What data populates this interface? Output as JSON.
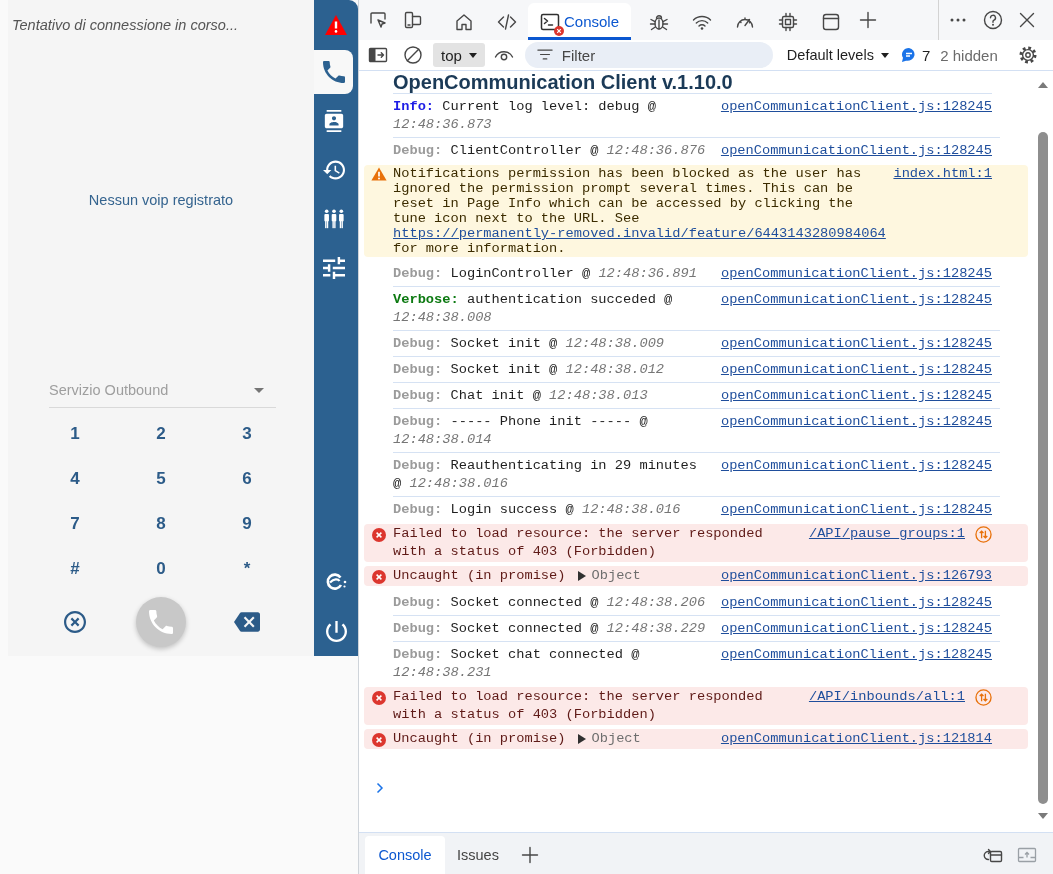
{
  "app": {
    "status": "Tentativo di connessione in corso...",
    "voip_message": "Nessun voip registrato",
    "service_select": {
      "placeholder": "Servizio Outbound"
    },
    "keypad": [
      "1",
      "2",
      "3",
      "4",
      "5",
      "6",
      "7",
      "8",
      "9",
      "#",
      "0",
      "*"
    ],
    "call_button": {
      "disabled": true
    }
  },
  "sidebar": {
    "alert": true,
    "items": [
      {
        "kind": "phone",
        "selected": true
      },
      {
        "kind": "contacts",
        "selected": false
      },
      {
        "kind": "history",
        "selected": false
      },
      {
        "kind": "people",
        "selected": false
      },
      {
        "kind": "tune",
        "selected": false
      }
    ]
  },
  "devtools": {
    "tabs": [
      {
        "kind": "home",
        "selected": false,
        "error_badge": false
      },
      {
        "kind": "code",
        "selected": false,
        "error_badge": false
      },
      {
        "kind": "console",
        "label": "Console",
        "selected": true,
        "error_badge": true
      },
      {
        "kind": "bug",
        "selected": false,
        "error_badge": false
      },
      {
        "kind": "wifi",
        "selected": false,
        "error_badge": false
      },
      {
        "kind": "gauge",
        "selected": false,
        "error_badge": false
      },
      {
        "kind": "chip",
        "selected": false,
        "error_badge": false
      },
      {
        "kind": "window",
        "selected": false,
        "error_badge": false
      }
    ],
    "toolbar": {
      "context": "top",
      "filter": {
        "placeholder": "Filter"
      },
      "levels": "Default levels",
      "message_count": "7",
      "hidden": "2 hidden"
    },
    "console": {
      "heading": "OpenCommunication Client v.1.10.0",
      "messages": [
        {
          "kind": "info",
          "prefix": "Info:",
          "text": "Current log level: debug @",
          "time": "12:48:36.873",
          "source": "openCommunicationClient.js:128245"
        },
        {
          "kind": "debug",
          "prefix": "Debug:",
          "text": "ClientController @",
          "time": "12:48:36.876",
          "source": "openCommunicationClient.js:128245"
        },
        {
          "kind": "warning",
          "text": "Notifications permission has been blocked as the user has ignored the permission prompt several times. This can be reset in Page Info which can be accessed by clicking the tune icon next to the URL. See",
          "url": "https://permanently-removed.invalid/feature/6443143280984064",
          "text_end": "for more information.",
          "source": "index.html:1"
        },
        {
          "kind": "debug",
          "prefix": "Debug:",
          "text": "LoginController @",
          "time": "12:48:36.891",
          "source": "openCommunicationClient.js:128245"
        },
        {
          "kind": "verbose",
          "prefix": "Verbose:",
          "text": "authentication succeded @",
          "time": "12:48:38.008",
          "source": "openCommunicationClient.js:128245"
        },
        {
          "kind": "debug",
          "prefix": "Debug:",
          "text": "Socket init @",
          "time": "12:48:38.009",
          "source": "openCommunicationClient.js:128245"
        },
        {
          "kind": "debug",
          "prefix": "Debug:",
          "text": "Socket init @",
          "time": "12:48:38.012",
          "source": "openCommunicationClient.js:128245"
        },
        {
          "kind": "debug",
          "prefix": "Debug:",
          "text": "Chat init @",
          "time": "12:48:38.013",
          "source": "openCommunicationClient.js:128245"
        },
        {
          "kind": "debug",
          "prefix": "Debug:",
          "text": "----- Phone init ----- @",
          "time": "12:48:38.014",
          "source": "openCommunicationClient.js:128245"
        },
        {
          "kind": "debug",
          "prefix": "Debug:",
          "text": "Reauthenticating in 29 minutes @",
          "time": "12:48:38.016",
          "source": "openCommunicationClient.js:128245"
        },
        {
          "kind": "debug",
          "prefix": "Debug:",
          "text": "Login success @",
          "time": "12:48:38.016",
          "source": "openCommunicationClient.js:128245"
        },
        {
          "kind": "error",
          "text": "Failed to load resource: the server responded with a status of 403 (Forbidden)",
          "source": "/API/pause_groups:1"
        },
        {
          "kind": "uncaught",
          "text": "Uncaught (in promise)",
          "object": "Object",
          "source": "openCommunicationClient.js:126793"
        },
        {
          "kind": "debug",
          "prefix": "Debug:",
          "text": "Socket connected @",
          "time": "12:48:38.206",
          "source": "openCommunicationClient.js:128245"
        },
        {
          "kind": "debug",
          "prefix": "Debug:",
          "text": "Socket connected @",
          "time": "12:48:38.229",
          "source": "openCommunicationClient.js:128245"
        },
        {
          "kind": "debug",
          "prefix": "Debug:",
          "text": "Socket chat connected @",
          "time": "12:48:38.231",
          "source": "openCommunicationClient.js:128245"
        },
        {
          "kind": "error",
          "text": "Failed to load resource: the server responded with a status of 403 (Forbidden)",
          "source": "/API/inbounds/all:1"
        },
        {
          "kind": "uncaught",
          "text": "Uncaught (in promise)",
          "object": "Object",
          "source": "openCommunicationClient.js:121814"
        }
      ]
    },
    "drawer_tabs": [
      {
        "label": "Console",
        "selected": true
      },
      {
        "label": "Issues",
        "selected": false
      }
    ]
  }
}
